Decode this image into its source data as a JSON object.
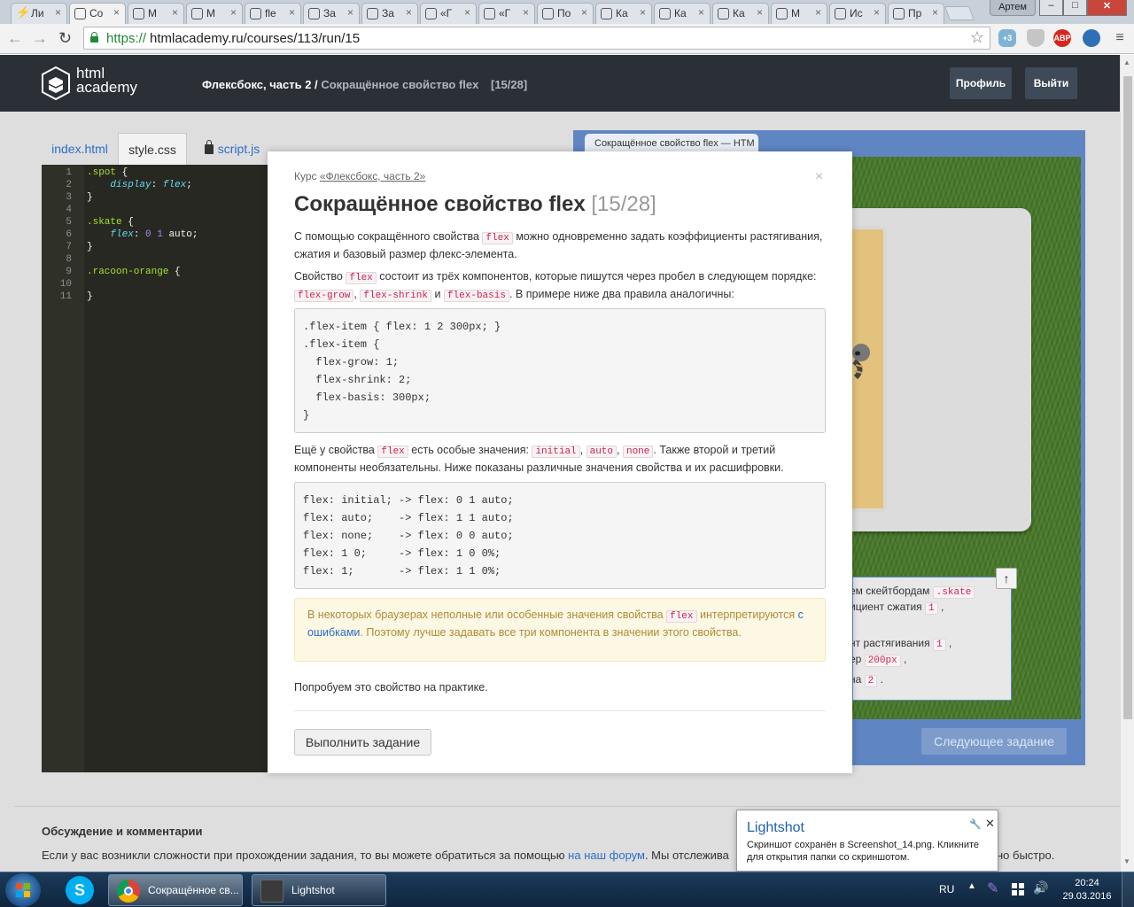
{
  "browser": {
    "tabs": [
      {
        "label": "Ли",
        "icon": "lightning-icon"
      },
      {
        "label": "Со",
        "icon": "htmlacademy-icon",
        "active": true
      },
      {
        "label": "М",
        "icon": "htmlacademy-icon"
      },
      {
        "label": "М",
        "icon": "htmlacademy-icon"
      },
      {
        "label": "fle",
        "icon": "htmlacademy-icon"
      },
      {
        "label": "За",
        "icon": "htmlacademy-icon"
      },
      {
        "label": "За",
        "icon": "htmlacademy-icon"
      },
      {
        "label": "«Г",
        "icon": "htmlacademy-icon"
      },
      {
        "label": "«Г",
        "icon": "htmlacademy-icon"
      },
      {
        "label": "По",
        "icon": "htmlacademy-icon"
      },
      {
        "label": "Ка",
        "icon": "htmlacademy-icon"
      },
      {
        "label": "Ка",
        "icon": "htmlacademy-icon"
      },
      {
        "label": "Ка",
        "icon": "htmlacademy-icon"
      },
      {
        "label": "М",
        "icon": "htmlacademy-icon"
      },
      {
        "label": "Ис",
        "icon": "htmlacademy-icon"
      },
      {
        "label": "Пр",
        "icon": "htmlacademy-icon"
      }
    ],
    "user": "Артем",
    "url_scheme": "https://",
    "url_rest": "htmlacademy.ru/courses/113/run/15",
    "ext_badge": "+3",
    "abp_label": "ABP"
  },
  "header": {
    "logo_line1": "html",
    "logo_line2": "academy",
    "crumb_course": "Флексбокс, часть 2 /",
    "crumb_current": "Сокращённое свойство flex",
    "crumb_count": "[15/28]",
    "profile_label": "Профиль",
    "logout_label": "Выйти"
  },
  "editor": {
    "tabs": [
      "index.html",
      "style.css",
      "script.js"
    ],
    "line_numbers": [
      "1",
      "2",
      "3",
      "4",
      "5",
      "6",
      "7",
      "8",
      "9",
      "10",
      "11"
    ]
  },
  "preview": {
    "tab_title": "Сокращённое свойство flex — HTM",
    "task_lines": [
      "ем скейтбордам",
      "ициент сжатия",
      "нт растягивания",
      "ер",
      "на"
    ],
    "task_codes": [
      ".skate",
      "1",
      "1",
      "200px",
      "2"
    ],
    "next_label": "Следующее задание"
  },
  "modal": {
    "course_prefix": "Курс",
    "course_link": "«Флексбокс, часть 2»",
    "title": "Сокращённое свойство flex",
    "step": "[15/28]",
    "p1_a": "С помощью сокращённого свойства",
    "p1_b": "можно одновременно задать коэффициенты растягивания, сжатия и базовый размер флекс-элемента.",
    "p2_a": "Свойство",
    "p2_b": "состоит из трёх компонентов, которые пишутся через пробел в следующем порядке:",
    "p2_c": "и",
    "p2_d": ". В примере ниже два правила аналогичны:",
    "code_flex": "flex",
    "code_grow": "flex-grow",
    "code_shrink": "flex-shrink",
    "code_basis": "flex-basis",
    "code1": ".flex-item { flex: 1 2 300px; }\n.flex-item {\n  flex-grow: 1;\n  flex-shrink: 2;\n  flex-basis: 300px;\n}",
    "p3_a": "Ещё у свойства",
    "p3_b": "есть особые значения:",
    "p3_c": ". Также второй и третий компоненты необязательны. Ниже показаны различные значения свойства и их расшифровки.",
    "code_initial": "initial",
    "code_auto": "auto",
    "code_none": "none",
    "code2": "flex: initial; -> flex: 0 1 auto;\nflex: auto;    -> flex: 1 1 auto;\nflex: none;    -> flex: 0 0 auto;\nflex: 1 0;     -> flex: 1 0 0%;\nflex: 1;       -> flex: 1 1 0%;",
    "note_a": "В некоторых браузерах неполные или особенные значения свойства",
    "note_b": "интерпретируются",
    "note_link": "с ошибками",
    "note_c": ". Поэтому лучше задавать все три компонента в значении этого свойства.",
    "p4": "Попробуем это свойство на практике.",
    "run_label": "Выполнить задание",
    "close_glyph": "×"
  },
  "discussion": {
    "title": "Обсуждение и комментарии",
    "text_a": "Если у вас возникли сложности при прохождении задания, то вы можете обратиться за помощью",
    "text_link": "на наш форум",
    "text_b": ". Мы отслежива",
    "text_tail": "но быстро."
  },
  "toast": {
    "title": "Lightshot",
    "message": "Скриншот сохранён в Screenshot_14.png. Кликните для открытия папки со скриншотом."
  },
  "taskbar": {
    "chrome_label": "Сокращённое св...",
    "lightshot_label": "Lightshot",
    "lang": "RU",
    "time": "20:24",
    "date": "29.03.2016"
  }
}
